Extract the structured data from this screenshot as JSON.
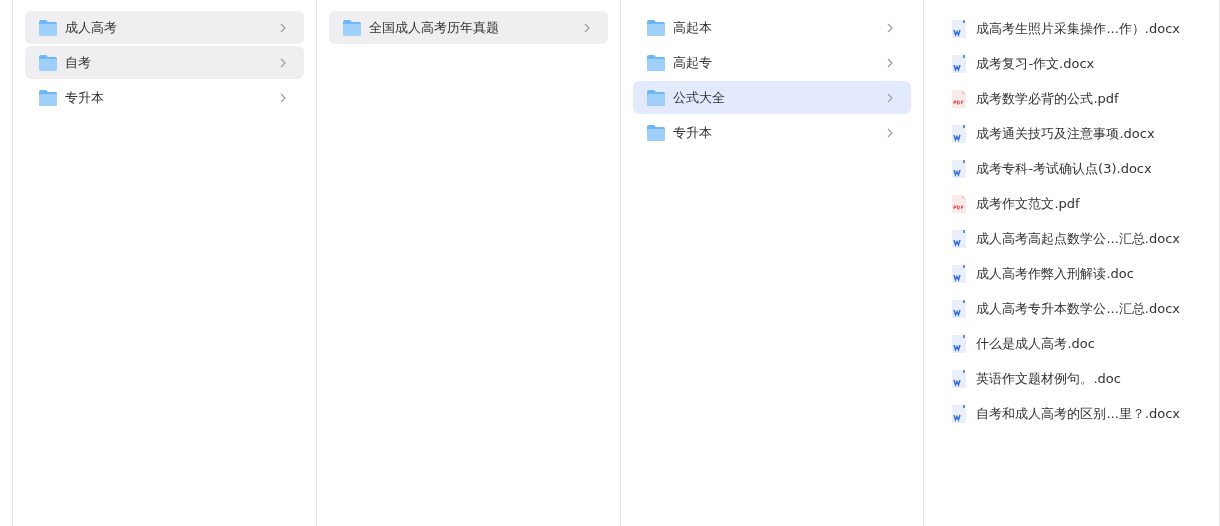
{
  "columns": [
    {
      "items": [
        {
          "name": "成人高考",
          "selected": false,
          "highlighted": true
        },
        {
          "name": "自考",
          "selected": false,
          "highlighted": true
        },
        {
          "name": "专升本",
          "selected": false,
          "highlighted": false
        }
      ]
    },
    {
      "items": [
        {
          "name": "全国成人高考历年真题",
          "selected": false,
          "highlighted": true
        }
      ]
    },
    {
      "items": [
        {
          "name": "高起本",
          "selected": false,
          "highlighted": false
        },
        {
          "name": "高起专",
          "selected": false,
          "highlighted": false
        },
        {
          "name": "公式大全",
          "selected": true,
          "highlighted": false
        },
        {
          "name": "专升本",
          "selected": false,
          "highlighted": false
        }
      ]
    }
  ],
  "files": [
    {
      "name": "成高考生照片采集操作...作）.docx",
      "kind": "word"
    },
    {
      "name": "成考复习-作文.docx",
      "kind": "word"
    },
    {
      "name": "成考数学必背的公式.pdf",
      "kind": "pdf"
    },
    {
      "name": "成考通关技巧及注意事项.docx",
      "kind": "word"
    },
    {
      "name": "成考专科-考试确认点(3).docx",
      "kind": "word"
    },
    {
      "name": "成考作文范文.pdf",
      "kind": "pdf"
    },
    {
      "name": "成人高考高起点数学公...汇总.docx",
      "kind": "word"
    },
    {
      "name": "成人高考作弊入刑解读.doc",
      "kind": "word"
    },
    {
      "name": "成人高考专升本数学公...汇总.docx",
      "kind": "word"
    },
    {
      "name": "什么是成人高考.doc",
      "kind": "word"
    },
    {
      "name": "英语作文题材例句。.doc",
      "kind": "word"
    },
    {
      "name": "自考和成人高考的区别...里？.docx",
      "kind": "word"
    }
  ]
}
